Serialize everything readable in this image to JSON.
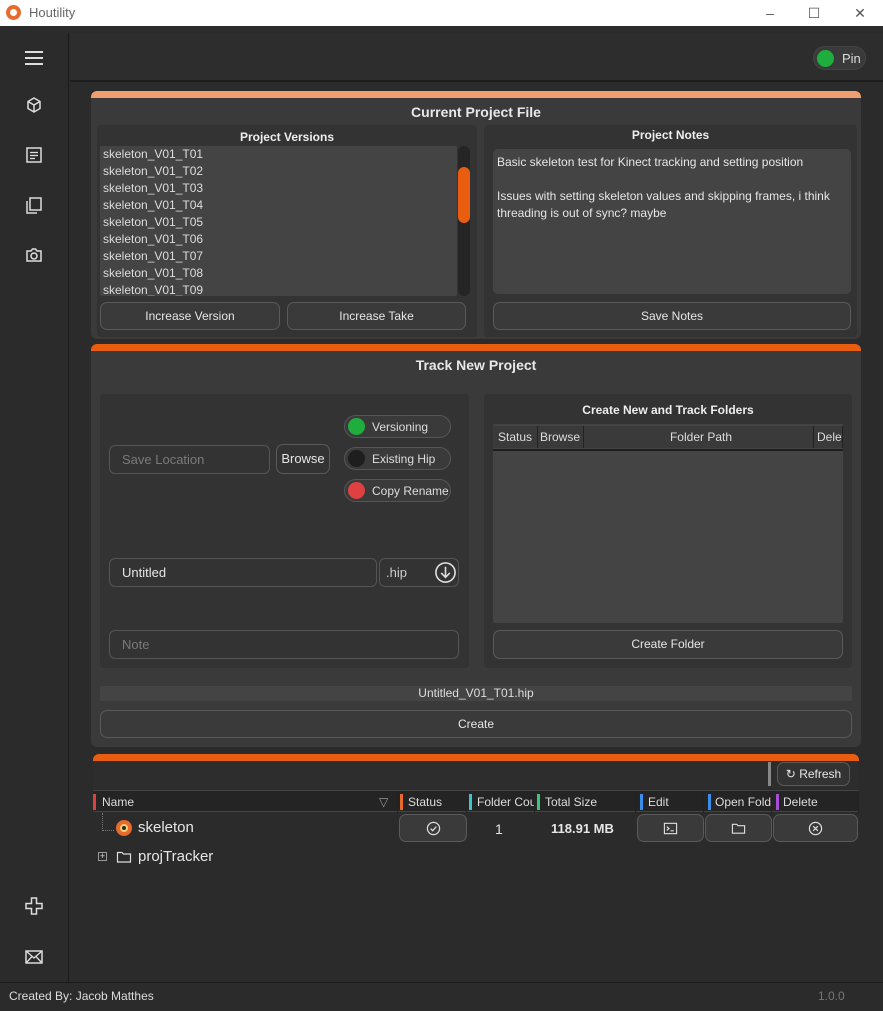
{
  "window": {
    "title": "Houtility",
    "minimize": "–",
    "maximize": "☐",
    "close": "✕"
  },
  "topbar": {
    "pin_label": "Pin",
    "pin_on": true,
    "pin_color": "#1fae3d"
  },
  "sidebar": {
    "items": [
      {
        "name": "menu-icon"
      },
      {
        "name": "cube-icon"
      },
      {
        "name": "document-icon"
      },
      {
        "name": "copy-icon"
      },
      {
        "name": "camera-icon"
      },
      {
        "name": "plus-icon"
      },
      {
        "name": "mail-icon"
      }
    ]
  },
  "current_project": {
    "title": "Current Project File",
    "accent": "#f0a070",
    "versions_title": "Project Versions",
    "versions": [
      "skeleton_V01_T01",
      "skeleton_V01_T02",
      "skeleton_V01_T03",
      "skeleton_V01_T04",
      "skeleton_V01_T05",
      "skeleton_V01_T06",
      "skeleton_V01_T07",
      "skeleton_V01_T08",
      "skeleton_V01_T09"
    ],
    "increase_version": "Increase Version",
    "increase_take": "Increase Take",
    "notes_title": "Project Notes",
    "notes_text": "Basic skeleton test for Kinect tracking and setting position\n\nIssues with setting skeleton values and skipping frames, i think threading is out of sync? maybe",
    "save_notes": "Save Notes"
  },
  "track_new": {
    "title": "Track New Project",
    "accent": "#e85d10",
    "save_location_placeholder": "Save Location",
    "browse": "Browse",
    "toggles": [
      {
        "label": "Versioning",
        "color": "#1fae3d"
      },
      {
        "label": "Existing Hip",
        "color": "#1e1e1e"
      },
      {
        "label": "Copy Rename",
        "color": "#e04040"
      }
    ],
    "name_value": "Untitled",
    "extension": ".hip",
    "note_placeholder": "Note",
    "folders_title": "Create New and Track Folders",
    "folder_columns": [
      "Status",
      "Browse",
      "Folder Path",
      "Delete"
    ],
    "create_folder": "Create Folder",
    "preview_filename": "Untitled_V01_T01.hip",
    "create": "Create"
  },
  "tracker": {
    "accent": "#e85d10",
    "refresh": "Refresh",
    "columns": [
      {
        "label": "Name",
        "color": "#e04040"
      },
      {
        "label": "Status",
        "color": "#e86a2c"
      },
      {
        "label": "Folder Count",
        "color": "#3bc7c7"
      },
      {
        "label": "Total Size",
        "color": "#3bc77a"
      },
      {
        "label": "Edit",
        "color": "#3a8de8"
      },
      {
        "label": "Open Folder",
        "color": "#3a8de8"
      },
      {
        "label": "Delete",
        "color": "#a64ed6"
      }
    ],
    "rows": [
      {
        "name": "skeleton",
        "folder_count": "1",
        "total_size": "118.91 MB"
      },
      {
        "name": "projTracker"
      }
    ]
  },
  "footer": {
    "credit": "Created By: Jacob Matthes",
    "version": "1.0.0"
  }
}
